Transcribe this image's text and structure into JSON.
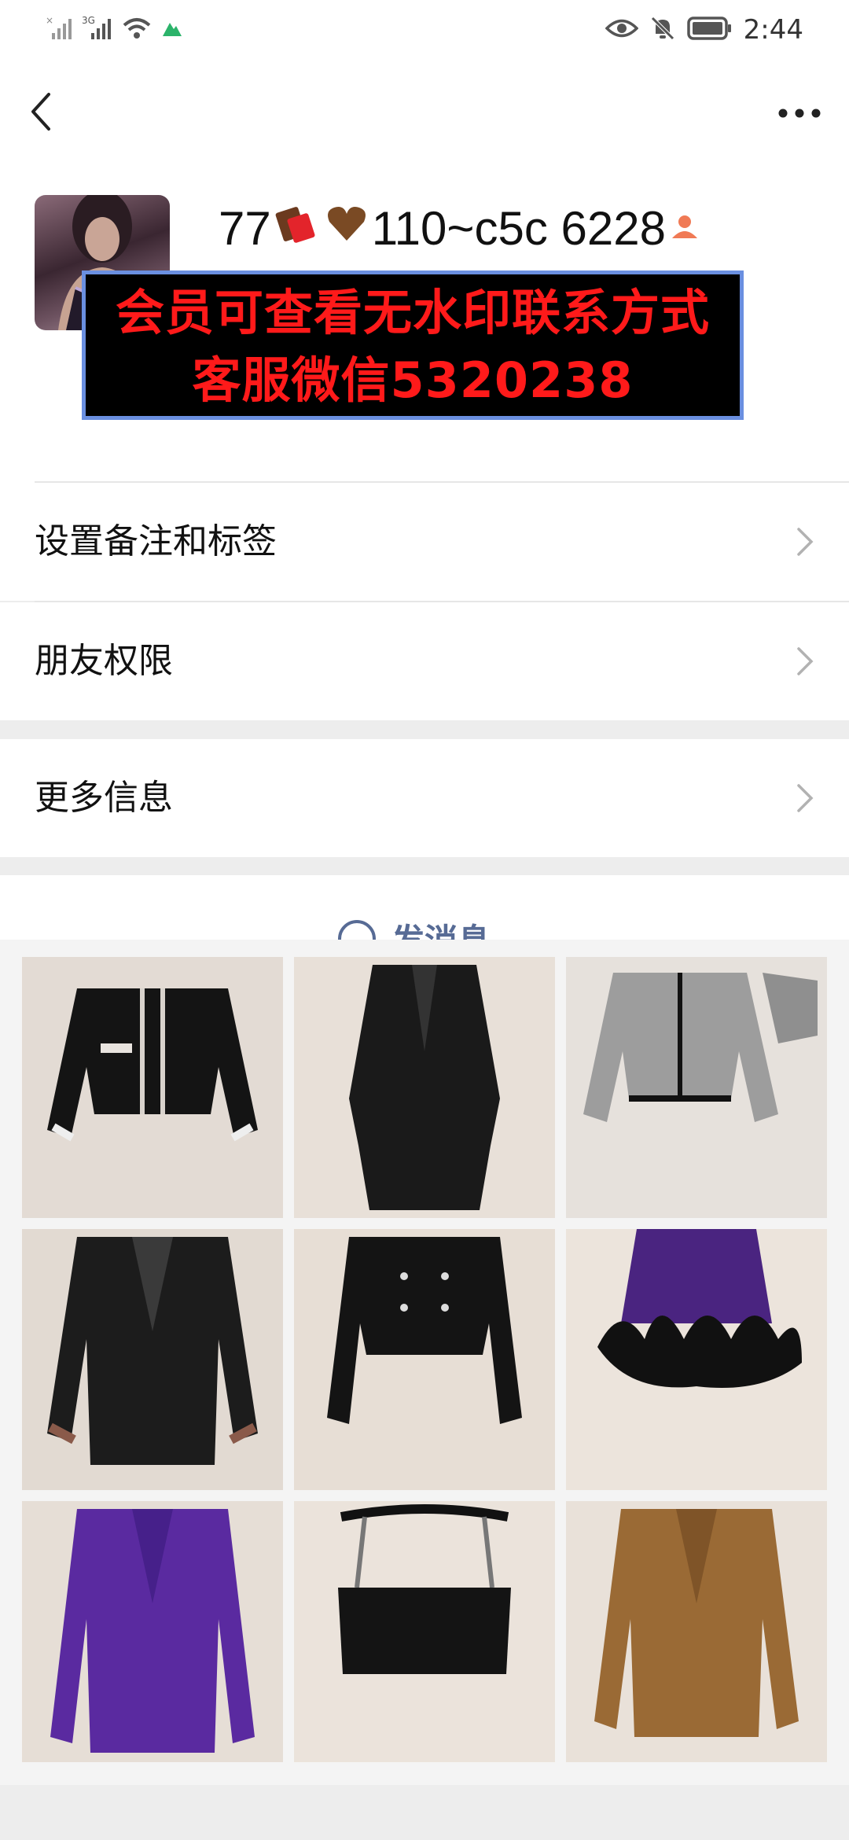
{
  "status_bar": {
    "time": "2:44",
    "network": "3G",
    "icons": [
      "no-sim-signal-icon",
      "signal-icon",
      "wifi-icon",
      "app-notification-icon",
      "eye-icon",
      "mute-bell-icon",
      "battery-icon"
    ]
  },
  "header": {
    "back_icon": "chevron-left-icon",
    "more_icon": "more-horizontal-icon"
  },
  "profile": {
    "name_prefix": "77",
    "name_middle": "110~c5c  6228",
    "emojis": [
      "chocolate-emoji",
      "brown-heart-emoji",
      "person-emoji"
    ],
    "watermark_line1": "会员可查看无水印联系方式",
    "watermark_line2": "客服微信5320238"
  },
  "menu": [
    {
      "label": "设置备注和标签"
    },
    {
      "label": "朋友权限"
    },
    {
      "label": "更多信息"
    }
  ],
  "send_message": {
    "label": "发消息"
  },
  "gallery": {
    "items": [
      {
        "name": "black-tweed-jacket-photo"
      },
      {
        "name": "black-long-coat-photo"
      },
      {
        "name": "grey-tweed-jacket-photo"
      },
      {
        "name": "black-leather-blazer-photo"
      },
      {
        "name": "black-cropped-jacket-photo"
      },
      {
        "name": "purple-feather-skirt-photo"
      },
      {
        "name": "purple-blazer-photo"
      },
      {
        "name": "black-crop-top-photo"
      },
      {
        "name": "camel-corduroy-jacket-photo"
      }
    ]
  },
  "colors": {
    "link_blue": "#576b95",
    "watermark_red": "#ff1a1a",
    "watermark_border": "#6a8fe0",
    "page_bg": "#ededed"
  }
}
